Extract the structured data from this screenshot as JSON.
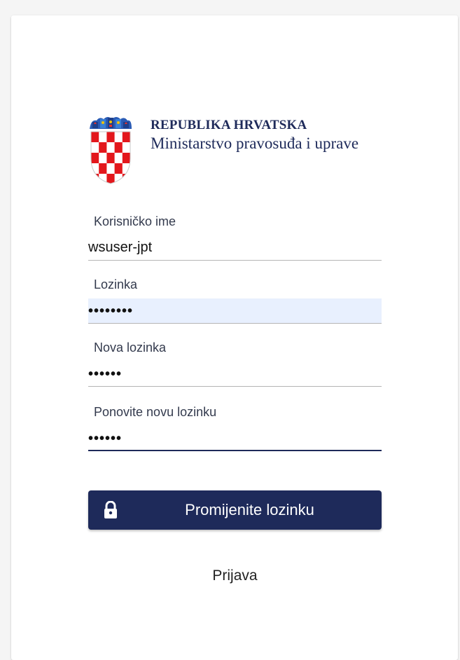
{
  "brand": {
    "line1": "REPUBLIKA HRVATSKA",
    "line2": "Ministarstvo pravosuđa i uprave",
    "logo_icon": "croatian-coat-of-arms-icon"
  },
  "form": {
    "username": {
      "label": "Korisničko ime",
      "value": "wsuser-jpt"
    },
    "password": {
      "label": "Lozinka",
      "value": "••••••••"
    },
    "new_password": {
      "label": "Nova lozinka",
      "value": "••••••"
    },
    "repeat_password": {
      "label": "Ponovite novu lozinku",
      "value": "••••••"
    }
  },
  "actions": {
    "submit_label": "Promijenite lozinku",
    "submit_icon": "lock-icon",
    "login_link": "Prijava"
  },
  "colors": {
    "primary": "#1e2a5a",
    "autofill_bg": "#e8f0fe",
    "background": "#f5f5f5"
  }
}
